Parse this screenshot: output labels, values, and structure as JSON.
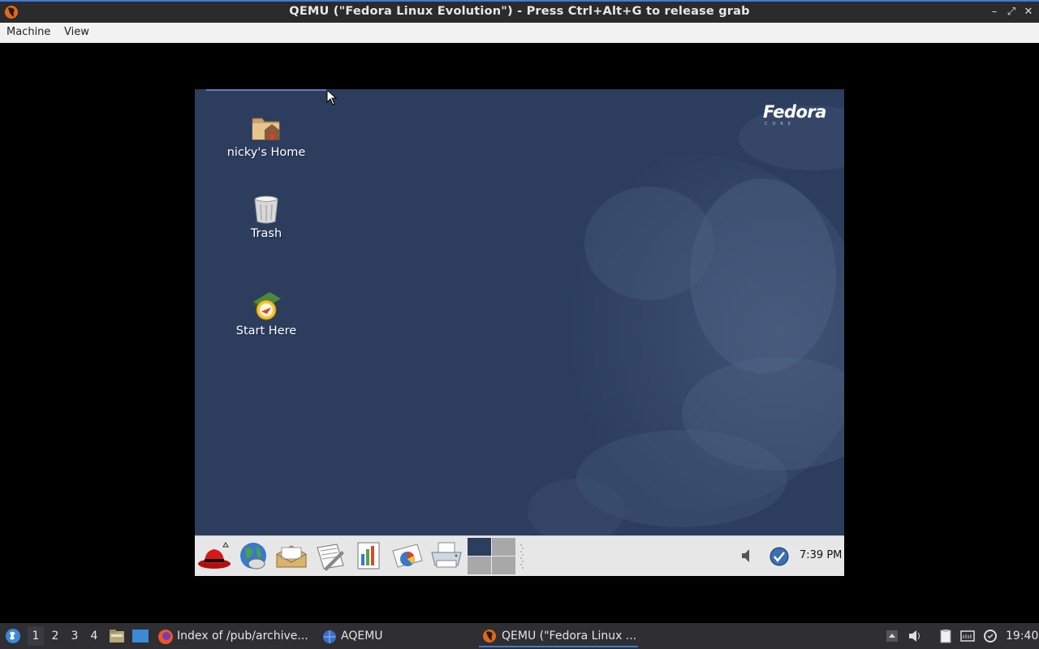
{
  "window": {
    "title": "QEMU (\"Fedora Linux Evolution\") - Press Ctrl+Alt+G to release grab",
    "controls": [
      "–",
      "⤢",
      "✕"
    ]
  },
  "menubar": {
    "items": [
      "Machine",
      "View"
    ]
  },
  "guest": {
    "logo": "Fedora",
    "logo_sub": "CORE",
    "desktop_icons": [
      {
        "label": "nicky's Home",
        "icon": "home-folder-icon"
      },
      {
        "label": "Trash",
        "icon": "trash-icon"
      },
      {
        "label": "Start Here",
        "icon": "start-here-icon"
      }
    ],
    "panel": {
      "launchers": [
        "redhat-menu-icon",
        "web-browser-icon",
        "email-icon",
        "text-editor-icon",
        "spreadsheet-icon",
        "presentation-icon",
        "printer-icon"
      ],
      "clock": "7:39 PM"
    }
  },
  "taskbar": {
    "workspaces": [
      "1",
      "2",
      "3",
      "4"
    ],
    "active_workspace": "1",
    "tasks": [
      {
        "label": "Index of /pub/archive...",
        "icon": "firefox-icon"
      },
      {
        "label": "AQEMU",
        "icon": "aqemu-icon"
      },
      {
        "label": "QEMU (\"Fedora Linux ...",
        "icon": "qemu-icon"
      }
    ],
    "clock": "19:40"
  },
  "colors": {
    "accent": "#3d7ad6",
    "wallpaper": "#2c3d5e",
    "host_bar": "#2b2b2b"
  }
}
